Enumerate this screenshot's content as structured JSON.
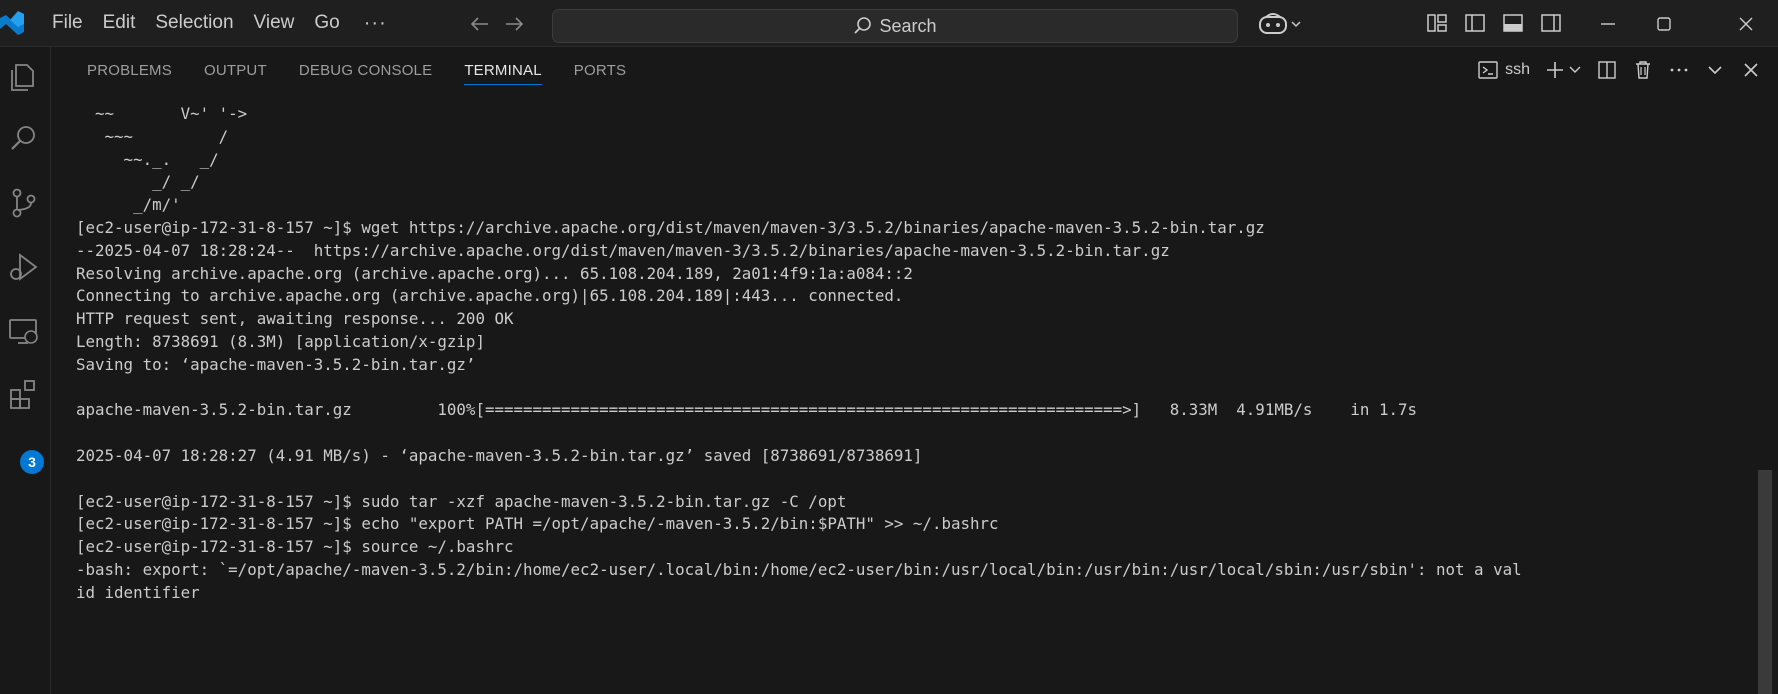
{
  "titlebar": {
    "menu": [
      "File",
      "Edit",
      "Selection",
      "View",
      "Go"
    ],
    "more": "···",
    "search_label": "Search"
  },
  "activitybar": {
    "icons": [
      "explorer-icon",
      "search-icon",
      "source-control-icon",
      "run-debug-icon",
      "remote-explorer-icon",
      "extensions-icon"
    ],
    "extensions_badge": "3"
  },
  "panel": {
    "tabs": [
      "PROBLEMS",
      "OUTPUT",
      "DEBUG CONSOLE",
      "TERMINAL",
      "PORTS"
    ],
    "active_tab": "TERMINAL",
    "terminal_name": "ssh"
  },
  "terminal": {
    "lines": [
      "  ~~       V~' '->",
      "   ~~~         /",
      "     ~~._.   _/",
      "        _/ _/",
      "      _/m/'",
      "[ec2-user@ip-172-31-8-157 ~]$ wget https://archive.apache.org/dist/maven/maven-3/3.5.2/binaries/apache-maven-3.5.2-bin.tar.gz",
      "--2025-04-07 18:28:24--  https://archive.apache.org/dist/maven/maven-3/3.5.2/binaries/apache-maven-3.5.2-bin.tar.gz",
      "Resolving archive.apache.org (archive.apache.org)... 65.108.204.189, 2a01:4f9:1a:a084::2",
      "Connecting to archive.apache.org (archive.apache.org)|65.108.204.189|:443... connected.",
      "HTTP request sent, awaiting response... 200 OK",
      "Length: 8738691 (8.3M) [application/x-gzip]",
      "Saving to: ‘apache-maven-3.5.2-bin.tar.gz’",
      "",
      "apache-maven-3.5.2-bin.tar.gz         100%[===================================================================>]   8.33M  4.91MB/s    in 1.7s",
      "",
      "2025-04-07 18:28:27 (4.91 MB/s) - ‘apache-maven-3.5.2-bin.tar.gz’ saved [8738691/8738691]",
      "",
      "[ec2-user@ip-172-31-8-157 ~]$ sudo tar -xzf apache-maven-3.5.2-bin.tar.gz -C /opt",
      "[ec2-user@ip-172-31-8-157 ~]$ echo \"export PATH =/opt/apache/-maven-3.5.2/bin:$PATH\" >> ~/.bashrc",
      "[ec2-user@ip-172-31-8-157 ~]$ source ~/.bashrc",
      "-bash: export: `=/opt/apache/-maven-3.5.2/bin:/home/ec2-user/.local/bin:/home/ec2-user/bin:/usr/local/bin:/usr/bin:/usr/local/sbin:/usr/sbin': not a val",
      "id identifier"
    ]
  },
  "colors": {
    "background": "#181818",
    "titlebar": "#1f1f1f",
    "accent": "#0078d4",
    "text": "#cccccc"
  }
}
